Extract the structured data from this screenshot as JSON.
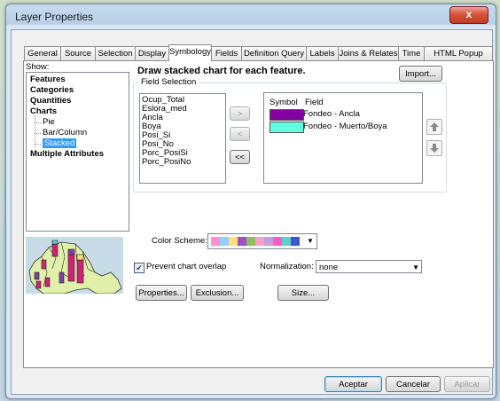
{
  "window": {
    "title": "Layer Properties",
    "close_glyph": "x"
  },
  "tabs": [
    {
      "label": "General"
    },
    {
      "label": "Source"
    },
    {
      "label": "Selection"
    },
    {
      "label": "Display"
    },
    {
      "label": "Symbology",
      "active": true
    },
    {
      "label": "Fields"
    },
    {
      "label": "Definition Query"
    },
    {
      "label": "Labels"
    },
    {
      "label": "Joins & Relates"
    },
    {
      "label": "Time"
    },
    {
      "label": "HTML Popup"
    }
  ],
  "show": {
    "label": "Show:",
    "items": [
      {
        "label": "Features",
        "bold": true
      },
      {
        "label": "Categories",
        "bold": true
      },
      {
        "label": "Quantities",
        "bold": true
      },
      {
        "label": "Charts",
        "bold": true
      },
      {
        "label": "Pie"
      },
      {
        "label": "Bar/Column"
      },
      {
        "label": "Stacked",
        "selected": true
      },
      {
        "label": "Multiple Attributes",
        "bold": true
      }
    ]
  },
  "heading": "Draw stacked chart for each feature.",
  "import_label": "Import...",
  "field_selection": {
    "legend": "Field Selection",
    "fields": [
      "Ocup_Total",
      "Eslora_med",
      "Ancla",
      "Boya",
      "Posi_Si",
      "Posi_No",
      "Porc_PosiSi",
      "Porc_PosiNo"
    ],
    "add_label": ">",
    "remove_label": "<",
    "remove_all_label": "<<"
  },
  "symbol_table": {
    "col_symbol": "Symbol",
    "col_field": "Field",
    "rows": [
      {
        "color": "#8000a0",
        "field": "Fondeo - Ancla"
      },
      {
        "color": "#60ffe0",
        "field": "Fondeo - Muerto/Boya"
      }
    ]
  },
  "color_scheme": {
    "label": "Color Scheme:",
    "colors": [
      "#ff8fd0",
      "#8fd0ff",
      "#ffe07a",
      "#a050c0",
      "#8fbf60",
      "#ff9ec8",
      "#c0a0e0",
      "#ff5cc4",
      "#5fd0c8",
      "#3a5ac8"
    ]
  },
  "prevent_overlap": {
    "label": "Prevent chart overlap",
    "checked": true
  },
  "normalization": {
    "label": "Normalization:",
    "value": "none"
  },
  "buttons": {
    "properties": "Properties...",
    "exclusion": "Exclusion...",
    "size": "Size..."
  },
  "footer": {
    "ok": "Aceptar",
    "cancel": "Cancelar",
    "apply": "Aplicar"
  }
}
